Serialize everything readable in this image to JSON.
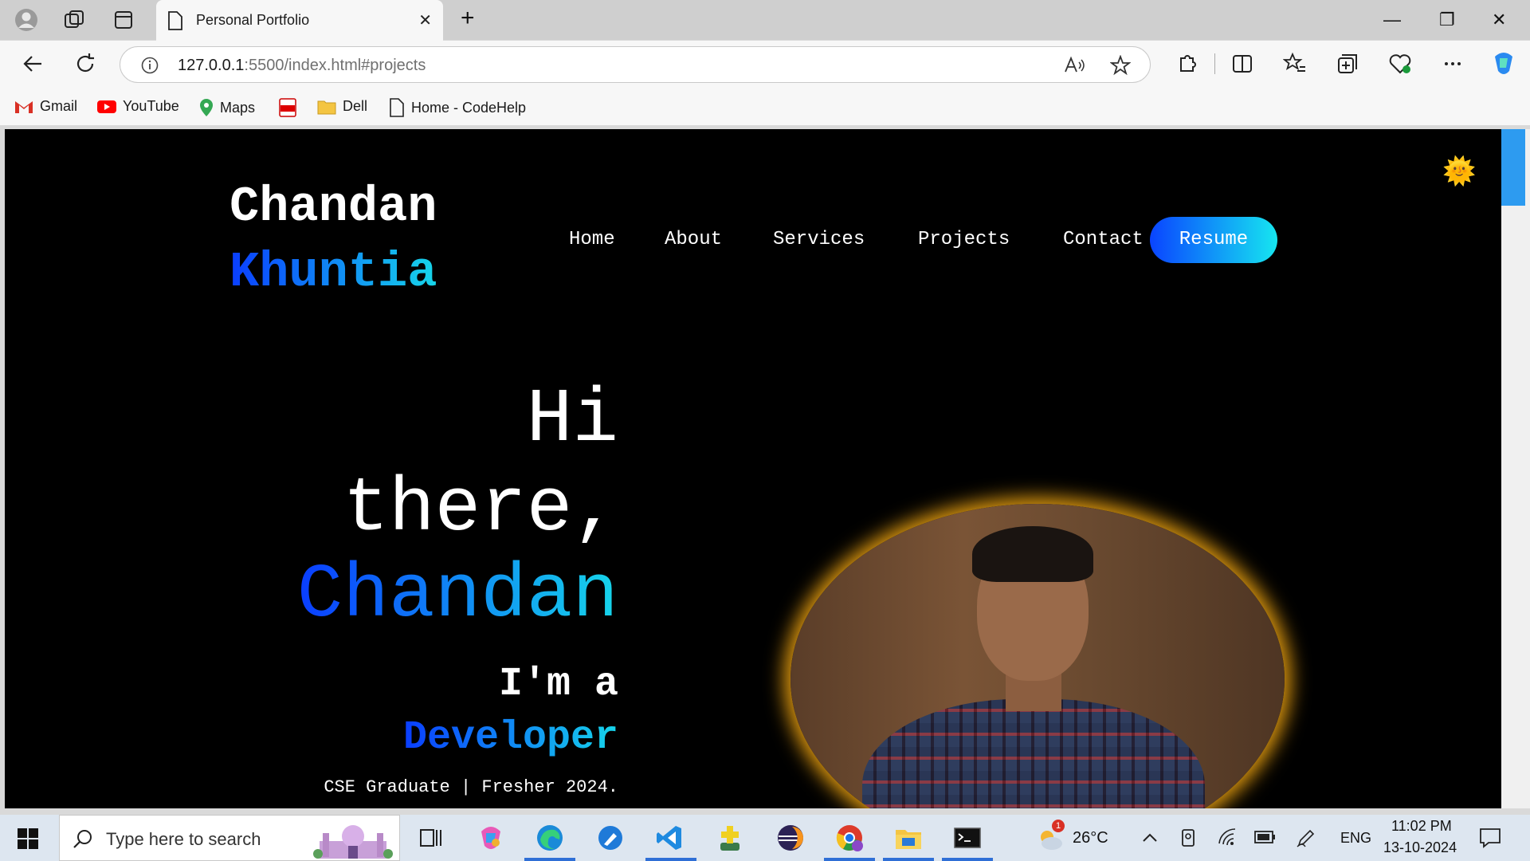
{
  "browser": {
    "tab_title": "Personal Portfolio",
    "tab_close": "✕",
    "new_tab": "+",
    "window": {
      "minimize": "—",
      "restore": "❐",
      "close": "✕"
    },
    "url_host": "127.0.0.1",
    "url_rest": ":5500/index.html#projects",
    "bookmarks": [
      {
        "label": "Gmail",
        "icon": "gmail-icon"
      },
      {
        "label": "YouTube",
        "icon": "youtube-icon"
      },
      {
        "label": "Maps",
        "icon": "maps-icon"
      },
      {
        "label": "",
        "icon": "pdf-icon"
      },
      {
        "label": "Dell",
        "icon": "folder-icon"
      },
      {
        "label": "Home - CodeHelp",
        "icon": "page-icon"
      }
    ]
  },
  "site": {
    "logo_first": "Chandan",
    "logo_last": "Khuntia",
    "nav": [
      "Home",
      "About",
      "Services",
      "Projects",
      "Contact"
    ],
    "resume": "Resume",
    "theme_toggle": "🌞",
    "hero": {
      "line1": "Hi",
      "line2": "there,",
      "name": "Chandan",
      "im_a": "I'm a",
      "role": "Developer",
      "tagline": "CSE Graduate | Fresher 2024."
    },
    "accent_gradient": [
      "#0a3dff",
      "#16d5ea"
    ],
    "photo_glow": "#e09a10"
  },
  "taskbar": {
    "search_placeholder": "Type here to search",
    "weather_temp": "26°C",
    "weather_badge": "1",
    "language": "ENG",
    "time": "11:02 PM",
    "date": "13-10-2024"
  }
}
